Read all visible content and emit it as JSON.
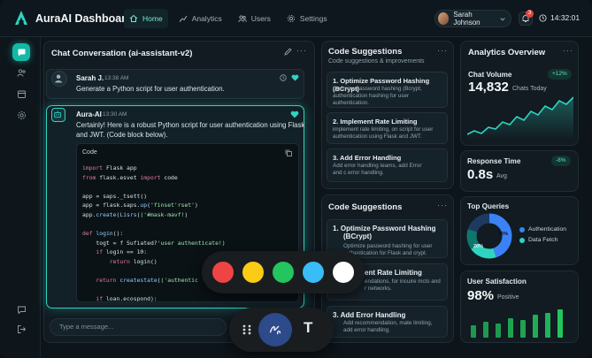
{
  "app": {
    "title": "AuraAI Dashboard"
  },
  "nav": [
    {
      "label": "Home",
      "icon": "home-icon",
      "active": true
    },
    {
      "label": "Analytics",
      "icon": "chart-icon",
      "active": false
    },
    {
      "label": "Users",
      "icon": "users-icon",
      "active": false
    },
    {
      "label": "Settings",
      "icon": "gear-icon",
      "active": false
    }
  ],
  "user": {
    "name": "Sarah Johnson",
    "notifications": "3",
    "time": "14:32:01"
  },
  "chat": {
    "title": "Chat Conversation (ai-assistant-v2)",
    "user_msg": {
      "name": "Sarah J.",
      "time": "13:38 AM",
      "text": "Generate a Python script for user authentication."
    },
    "ai_msg": {
      "name": "Aura-AI",
      "time": "13:30 AM",
      "text_line1": "Certainly! Here is a robust Python script for user authentication using Flask",
      "text_line2": "and JWT. (Code block below)."
    },
    "code_label": "Code",
    "input_placeholder": "Type a message..."
  },
  "suggestions_top": {
    "title": "Code Suggestions",
    "subtitle": "Code suggestions & improvements",
    "items": [
      {
        "title": "1. Optimize Password Hashing (BCrypt)",
        "desc1": "Optimize password hashing (Bcrypt,",
        "desc2": "authentication hashing for user",
        "desc3": "authentication."
      },
      {
        "title": "2. Implement Rate Limiting",
        "desc1": "implement rate limiting, on script for user",
        "desc2": "authentication using Flask and JWT.",
        "desc3": ""
      },
      {
        "title": "3. Add Error Handling",
        "desc1": "Add error handling teams, add Error",
        "desc2": "and c error handling.",
        "desc3": ""
      }
    ]
  },
  "suggestions_bottom": {
    "title": "Code Suggestions",
    "items": [
      {
        "title1": "1.  Optimize Password Hashing",
        "title2": "(BCrypt)",
        "desc1": "Optimize password hashing for user",
        "desc2": "authentication for Flask and crypt."
      },
      {
        "title1": "ent Rate Limiting",
        "title2": "",
        "desc1": "endations, for incuire mcts and",
        "desc2": "r networks."
      },
      {
        "title1": "3.  Add Error Handling",
        "title2": "",
        "desc1": "Add recommendation, mate limiting,",
        "desc2": "add error handling."
      }
    ]
  },
  "analytics": {
    "title": "Analytics Overview",
    "chat_volume": {
      "label": "Chat Volume",
      "value": "14,832",
      "unit": "Chats Today",
      "change": "+12%"
    },
    "response_time": {
      "label": "Response Time",
      "value": "0.8s",
      "unit": "Avg",
      "change": "-8%"
    },
    "top_queries": {
      "label": "Top Queries",
      "legend": [
        {
          "name": "Authentication",
          "color": "#3b82f6"
        },
        {
          "name": "Data Fetch",
          "color": "#2dd4bf"
        }
      ],
      "slice_labels": [
        "45%",
        "20%"
      ],
      "slices": [
        {
          "value": 45,
          "color": "#3b82f6"
        },
        {
          "value": 20,
          "color": "#2dd4bf"
        },
        {
          "value": 15,
          "color": "#0f766e"
        },
        {
          "value": 20,
          "color": "#1e3a5f"
        }
      ]
    },
    "satisfaction": {
      "label": "User Satisfaction",
      "value": "98%",
      "unit": "Positive"
    }
  },
  "palette_colors": [
    "#ef4444",
    "#facc15",
    "#22c55e",
    "#38bdf8",
    "#ffffff"
  ]
}
